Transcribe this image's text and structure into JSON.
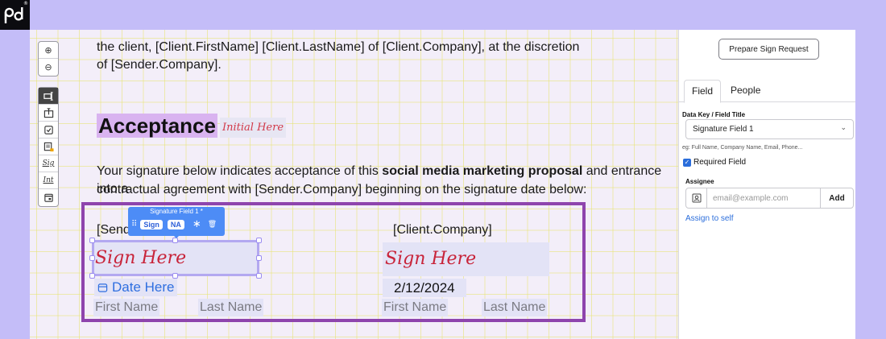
{
  "brand": {
    "logo_text": "pd",
    "registered": "®"
  },
  "toolbar": {
    "zoom_in": "⊕",
    "zoom_out": "⊖",
    "tools": [
      {
        "icon": "text-field-icon"
      },
      {
        "icon": "text-insert-icon"
      },
      {
        "icon": "checkbox-icon"
      },
      {
        "icon": "locked-form-icon"
      },
      {
        "icon": "signature-icon",
        "label": "Sig"
      },
      {
        "icon": "initial-icon",
        "label": "Int"
      },
      {
        "icon": "date-icon"
      }
    ]
  },
  "document": {
    "intro_line1": "the client, [Client.FirstName] [Client.LastName] of [Client.Company], at the discretion",
    "intro_line2": "of [Sender.Company].",
    "heading": "Acceptance",
    "initial_placeholder": "Initial Here",
    "body_pre": "Your signature below indicates acceptance of this ",
    "body_bold": "social media marketing proposal",
    "body_post": " and entrance into a",
    "body_line2": "contractual agreement with [Sender.Company] beginning on the signature date below:",
    "sender_label": "[Send",
    "client_label": "[Client.Company]",
    "sign_here_left": "Sign Here",
    "sign_here_right": "Sign Here",
    "date_here": "Date Here",
    "client_date": "2/12/2024",
    "first_name": "First Name",
    "last_name": "Last Name"
  },
  "field_toolbar": {
    "title": "Signature Field 1 *",
    "drag": "⠿",
    "sign": "Sign",
    "na": "NA",
    "required": "∗",
    "delete": "🗑"
  },
  "panel": {
    "prepare_button": "Prepare Sign Request",
    "tabs": [
      "Field",
      "People"
    ],
    "data_key_label": "Data Key / Field Title",
    "field_title_value": "Signature Field 1",
    "chevron": "⌄",
    "hint": "eg: Full Name, Company Name, Email, Phone...",
    "required_label": "Required Field",
    "checkmark": "✓",
    "assignee_label": "Assignee",
    "email_placeholder": "email@example.com",
    "add_button": "Add",
    "assign_self": "Assign to self"
  },
  "colors": {
    "background": "#c4bdf8",
    "accent_purple": "#8e44ad",
    "field_fill": "#e3e3f6",
    "signature_red": "#c8243a",
    "link_blue": "#2a6ddb",
    "toolbar_blue": "#4d8cf6"
  }
}
